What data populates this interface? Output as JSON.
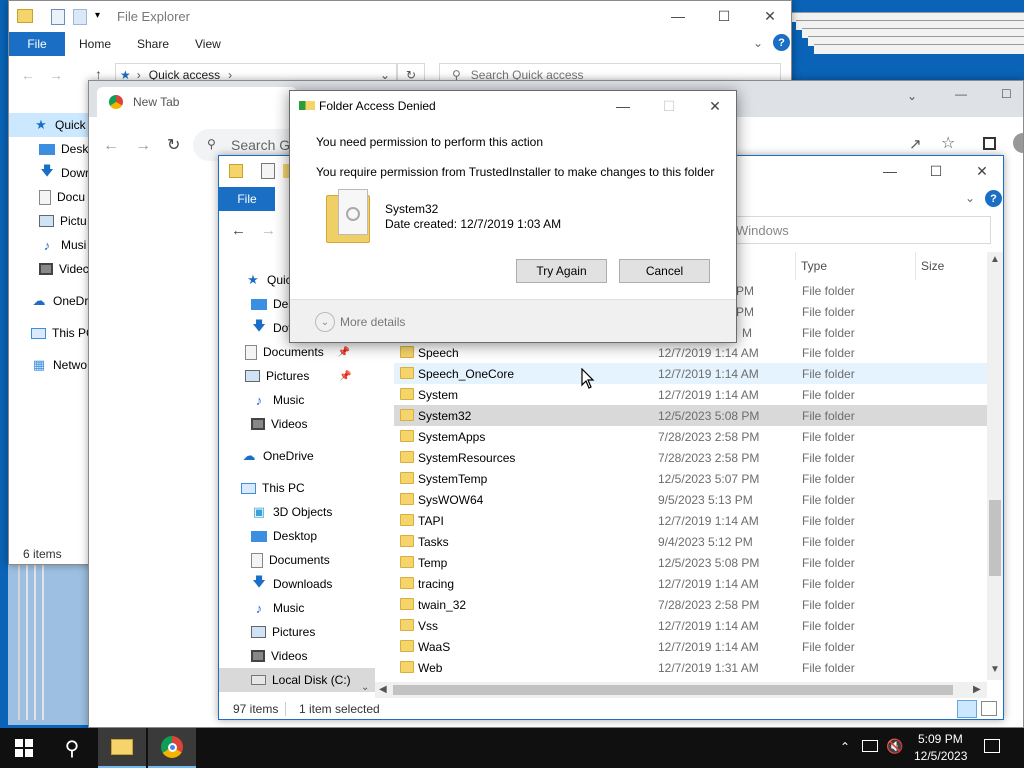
{
  "desktop": {
    "background": "#0a63b6"
  },
  "back_explorer": {
    "title": "File Explorer",
    "tabs": {
      "file": "File",
      "home": "Home",
      "share": "Share",
      "view": "View"
    },
    "address": "Quick access",
    "search_placeholder": "Search Quick access",
    "nav": [
      "Quick",
      "Deskt",
      "Dowr",
      "Docu",
      "Pictu",
      "Musi",
      "Videc",
      "OneDr",
      "This PC",
      "Netwo"
    ],
    "status": "6 items"
  },
  "chrome": {
    "tab_title": "New Tab",
    "search_placeholder": "Search Go"
  },
  "front_explorer": {
    "tabs": {
      "file": "File"
    },
    "address": "Windows",
    "columns": {
      "type": "Type",
      "size": "Size"
    },
    "partial_rows": [
      {
        "date": "PM",
        "type": "File folder"
      },
      {
        "date": "PM",
        "type": "File folder"
      },
      {
        "date": "M",
        "type": "File folder"
      }
    ],
    "rows": [
      {
        "name": "Speech",
        "date": "12/7/2019 1:14 AM",
        "type": "File folder"
      },
      {
        "name": "Speech_OneCore",
        "date": "12/7/2019 1:14 AM",
        "type": "File folder"
      },
      {
        "name": "System",
        "date": "12/7/2019 1:14 AM",
        "type": "File folder"
      },
      {
        "name": "System32",
        "date": "12/5/2023 5:08 PM",
        "type": "File folder"
      },
      {
        "name": "SystemApps",
        "date": "7/28/2023 2:58 PM",
        "type": "File folder"
      },
      {
        "name": "SystemResources",
        "date": "7/28/2023 2:58 PM",
        "type": "File folder"
      },
      {
        "name": "SystemTemp",
        "date": "12/5/2023 5:07 PM",
        "type": "File folder"
      },
      {
        "name": "SysWOW64",
        "date": "9/5/2023 5:13 PM",
        "type": "File folder"
      },
      {
        "name": "TAPI",
        "date": "12/7/2019 1:14 AM",
        "type": "File folder"
      },
      {
        "name": "Tasks",
        "date": "9/4/2023 5:12 PM",
        "type": "File folder"
      },
      {
        "name": "Temp",
        "date": "12/5/2023 5:08 PM",
        "type": "File folder"
      },
      {
        "name": "tracing",
        "date": "12/7/2019 1:14 AM",
        "type": "File folder"
      },
      {
        "name": "twain_32",
        "date": "7/28/2023 2:58 PM",
        "type": "File folder"
      },
      {
        "name": "Vss",
        "date": "12/7/2019 1:14 AM",
        "type": "File folder"
      },
      {
        "name": "WaaS",
        "date": "12/7/2019 1:14 AM",
        "type": "File folder"
      },
      {
        "name": "Web",
        "date": "12/7/2019 1:31 AM",
        "type": "File folder"
      }
    ],
    "nav": {
      "quick": "Quic",
      "desktop": "Des",
      "downloads": "Dov",
      "documents": "Documents",
      "pictures": "Pictures",
      "music": "Music",
      "videos": "Videos",
      "onedrive": "OneDrive",
      "thispc": "This PC",
      "objects3d": "3D Objects",
      "pc_desktop": "Desktop",
      "pc_documents": "Documents",
      "pc_downloads": "Downloads",
      "pc_music": "Music",
      "pc_pictures": "Pictures",
      "pc_videos": "Videos",
      "localdisk": "Local Disk (C:)"
    },
    "status": {
      "count": "97 items",
      "selected": "1 item selected"
    }
  },
  "dialog": {
    "title": "Folder Access Denied",
    "line1": "You need permission to perform this action",
    "line2": "You require permission from TrustedInstaller to make changes to this folder",
    "folder_name": "System32",
    "folder_date": "Date created: 12/7/2019 1:03 AM",
    "try_again": "Try Again",
    "cancel": "Cancel",
    "more_details": "More details"
  },
  "taskbar": {
    "time": "5:09 PM",
    "date": "12/5/2023"
  },
  "colors": {
    "accent": "#1a6fc4",
    "selected_row": "#d9d9d9",
    "hover_row": "#e5f3ff",
    "folder": "#f5d46b"
  }
}
